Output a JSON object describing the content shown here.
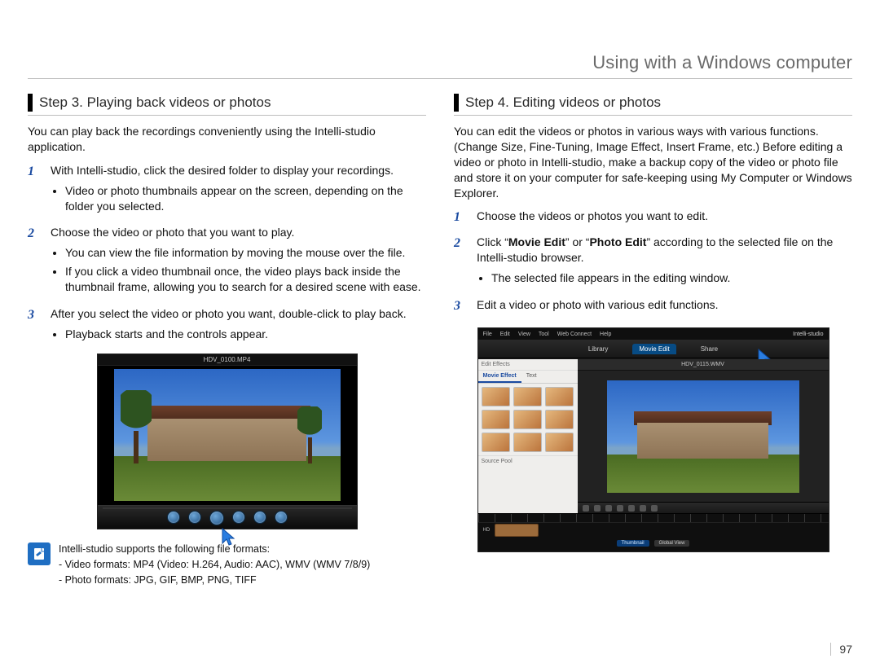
{
  "page_title": "Using with a Windows computer",
  "page_number": "97",
  "left": {
    "step_title": "Step 3. Playing back videos or photos",
    "intro": "You can play back the recordings conveniently using the Intelli-studio application.",
    "items": [
      {
        "n": "1",
        "text": "With Intelli-studio, click the desired folder to display your recordings.",
        "sub": [
          "Video or photo thumbnails appear on the screen, depending on the folder you selected."
        ]
      },
      {
        "n": "2",
        "text": "Choose the video or photo that you want to play.",
        "sub": [
          "You can view the file information by moving the mouse over the file.",
          "If you click a video thumbnail once, the video plays back inside the thumbnail frame, allowing you to search for a desired scene with ease."
        ]
      },
      {
        "n": "3",
        "text": "After you select the video or photo you want, double-click to play back.",
        "sub": [
          "Playback starts and the controls appear."
        ]
      }
    ],
    "playback_window_title": "HDV_0100.MP4"
  },
  "right": {
    "step_title": "Step 4. Editing videos or photos",
    "intro_parts": [
      "You can edit the videos or photos in various ways with various functions. (Change Size, Fine-Tuning, Image Effect, Insert Frame, etc.) Before editing a video or photo in Intelli-studio, make a backup copy of the video or photo file and store it on your computer for safe-keeping using My Computer or Windows Explorer."
    ],
    "items": [
      {
        "n": "1",
        "text": "Choose the videos or photos you want to edit.",
        "sub": []
      },
      {
        "n": "2",
        "pre": "Click “",
        "bold1": "Movie Edit",
        "mid": "” or “",
        "bold2": "Photo Edit",
        "post": "” according to the selected file on the Intelli-studio browser.",
        "sub": [
          "The selected file appears in the editing window."
        ]
      },
      {
        "n": "3",
        "text": "Edit a video or photo with various edit functions.",
        "sub": []
      }
    ],
    "editor": {
      "app_name": "Intelli-studio",
      "menu": [
        "File",
        "Edit",
        "View",
        "Tool",
        "Web Connect",
        "Help"
      ],
      "tabs": [
        "Library",
        "Movie Edit",
        "Share"
      ],
      "active_tab": 1,
      "filename": "HDV_0115.WMV",
      "left_panel": {
        "tabs": [
          "Movie Effect",
          "Text"
        ],
        "section_top": "Edit Effects",
        "section_bottom": "Source Pool"
      },
      "timeline_buttons": [
        "Thumbnail",
        "Global View"
      ],
      "timeline_track_label": "HD"
    }
  },
  "note": {
    "line1": "Intelli-studio supports the following file formats:",
    "line2": "- Video formats: MP4 (Video: H.264, Audio: AAC), WMV (WMV 7/8/9)",
    "line3": "- Photo formats: JPG, GIF, BMP, PNG, TIFF"
  }
}
